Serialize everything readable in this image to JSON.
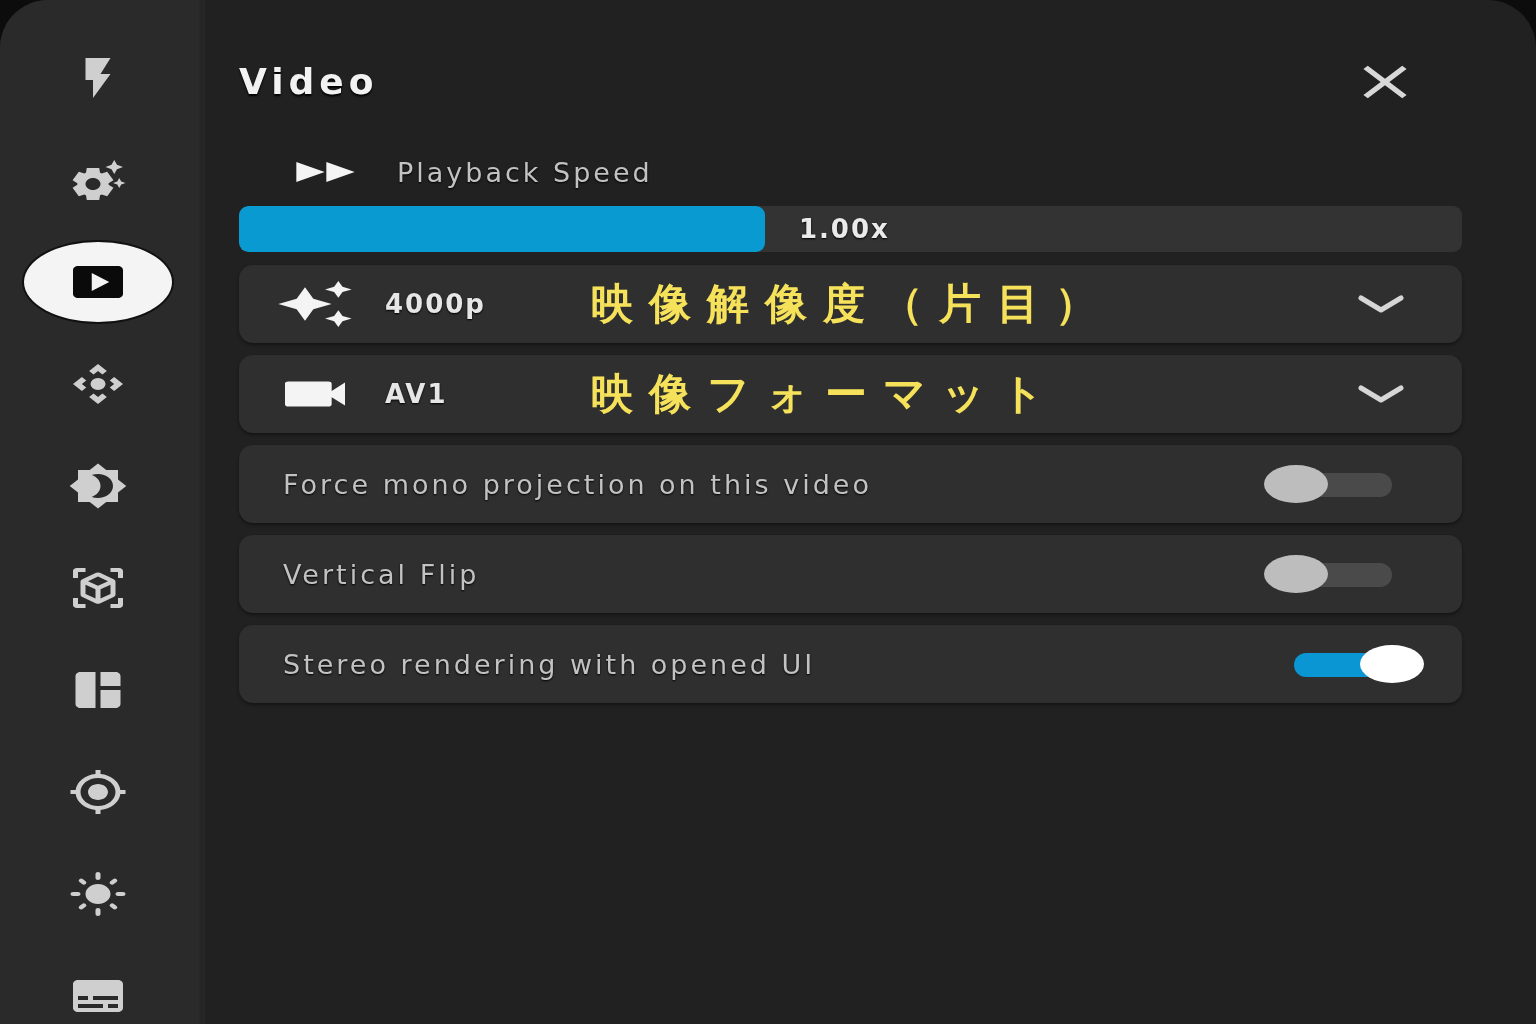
{
  "sidebar": {
    "items": [
      {
        "selected": false
      },
      {
        "selected": false
      },
      {
        "selected": true
      },
      {
        "selected": false
      },
      {
        "selected": false
      },
      {
        "selected": false
      },
      {
        "selected": false
      },
      {
        "selected": false
      },
      {
        "selected": false
      },
      {
        "selected": false
      }
    ]
  },
  "panel": {
    "title": "Video"
  },
  "playback": {
    "label": "Playback Speed",
    "level": 0.43,
    "reading": "1.00x"
  },
  "dropdowns": [
    {
      "value": "4000p",
      "annotation": "映像解像度（片目）"
    },
    {
      "value": "AV1",
      "annotation": "映像フォーマット"
    }
  ],
  "toggles": [
    {
      "label": "Force mono projection on this video",
      "on": false
    },
    {
      "label": "Vertical Flip",
      "on": false
    },
    {
      "label": "Stereo rendering with opened UI",
      "on": true
    }
  ]
}
